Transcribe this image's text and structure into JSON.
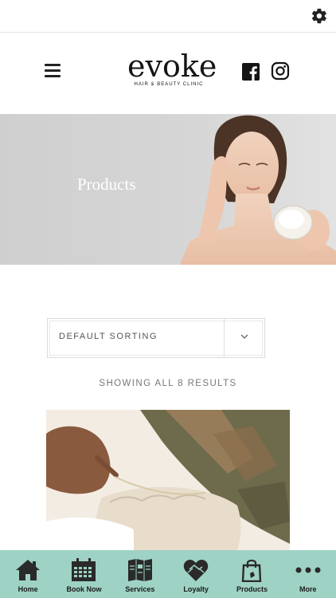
{
  "topbar": {
    "settings_icon": "gear-icon"
  },
  "header": {
    "logo_word": "evoke",
    "logo_tagline": "HAIR & BEAUTY CLINIC",
    "menu_icon": "hamburger-icon",
    "social": [
      "facebook-icon",
      "instagram-icon"
    ]
  },
  "hero": {
    "title": "Products"
  },
  "shop": {
    "sorting": "DEFAULT SORTING",
    "results": "SHOWING ALL 8 RESULTS"
  },
  "tabbar": {
    "accent": "#9ed2c4",
    "items": [
      {
        "label": "Home",
        "icon": "home-icon"
      },
      {
        "label": "Book Now",
        "icon": "calendar-icon"
      },
      {
        "label": "Services",
        "icon": "brochure-icon"
      },
      {
        "label": "Loyalty",
        "icon": "heart-hands-icon"
      },
      {
        "label": "Products",
        "icon": "shopping-bag-icon"
      },
      {
        "label": "More",
        "icon": "more-dots-icon"
      }
    ]
  }
}
